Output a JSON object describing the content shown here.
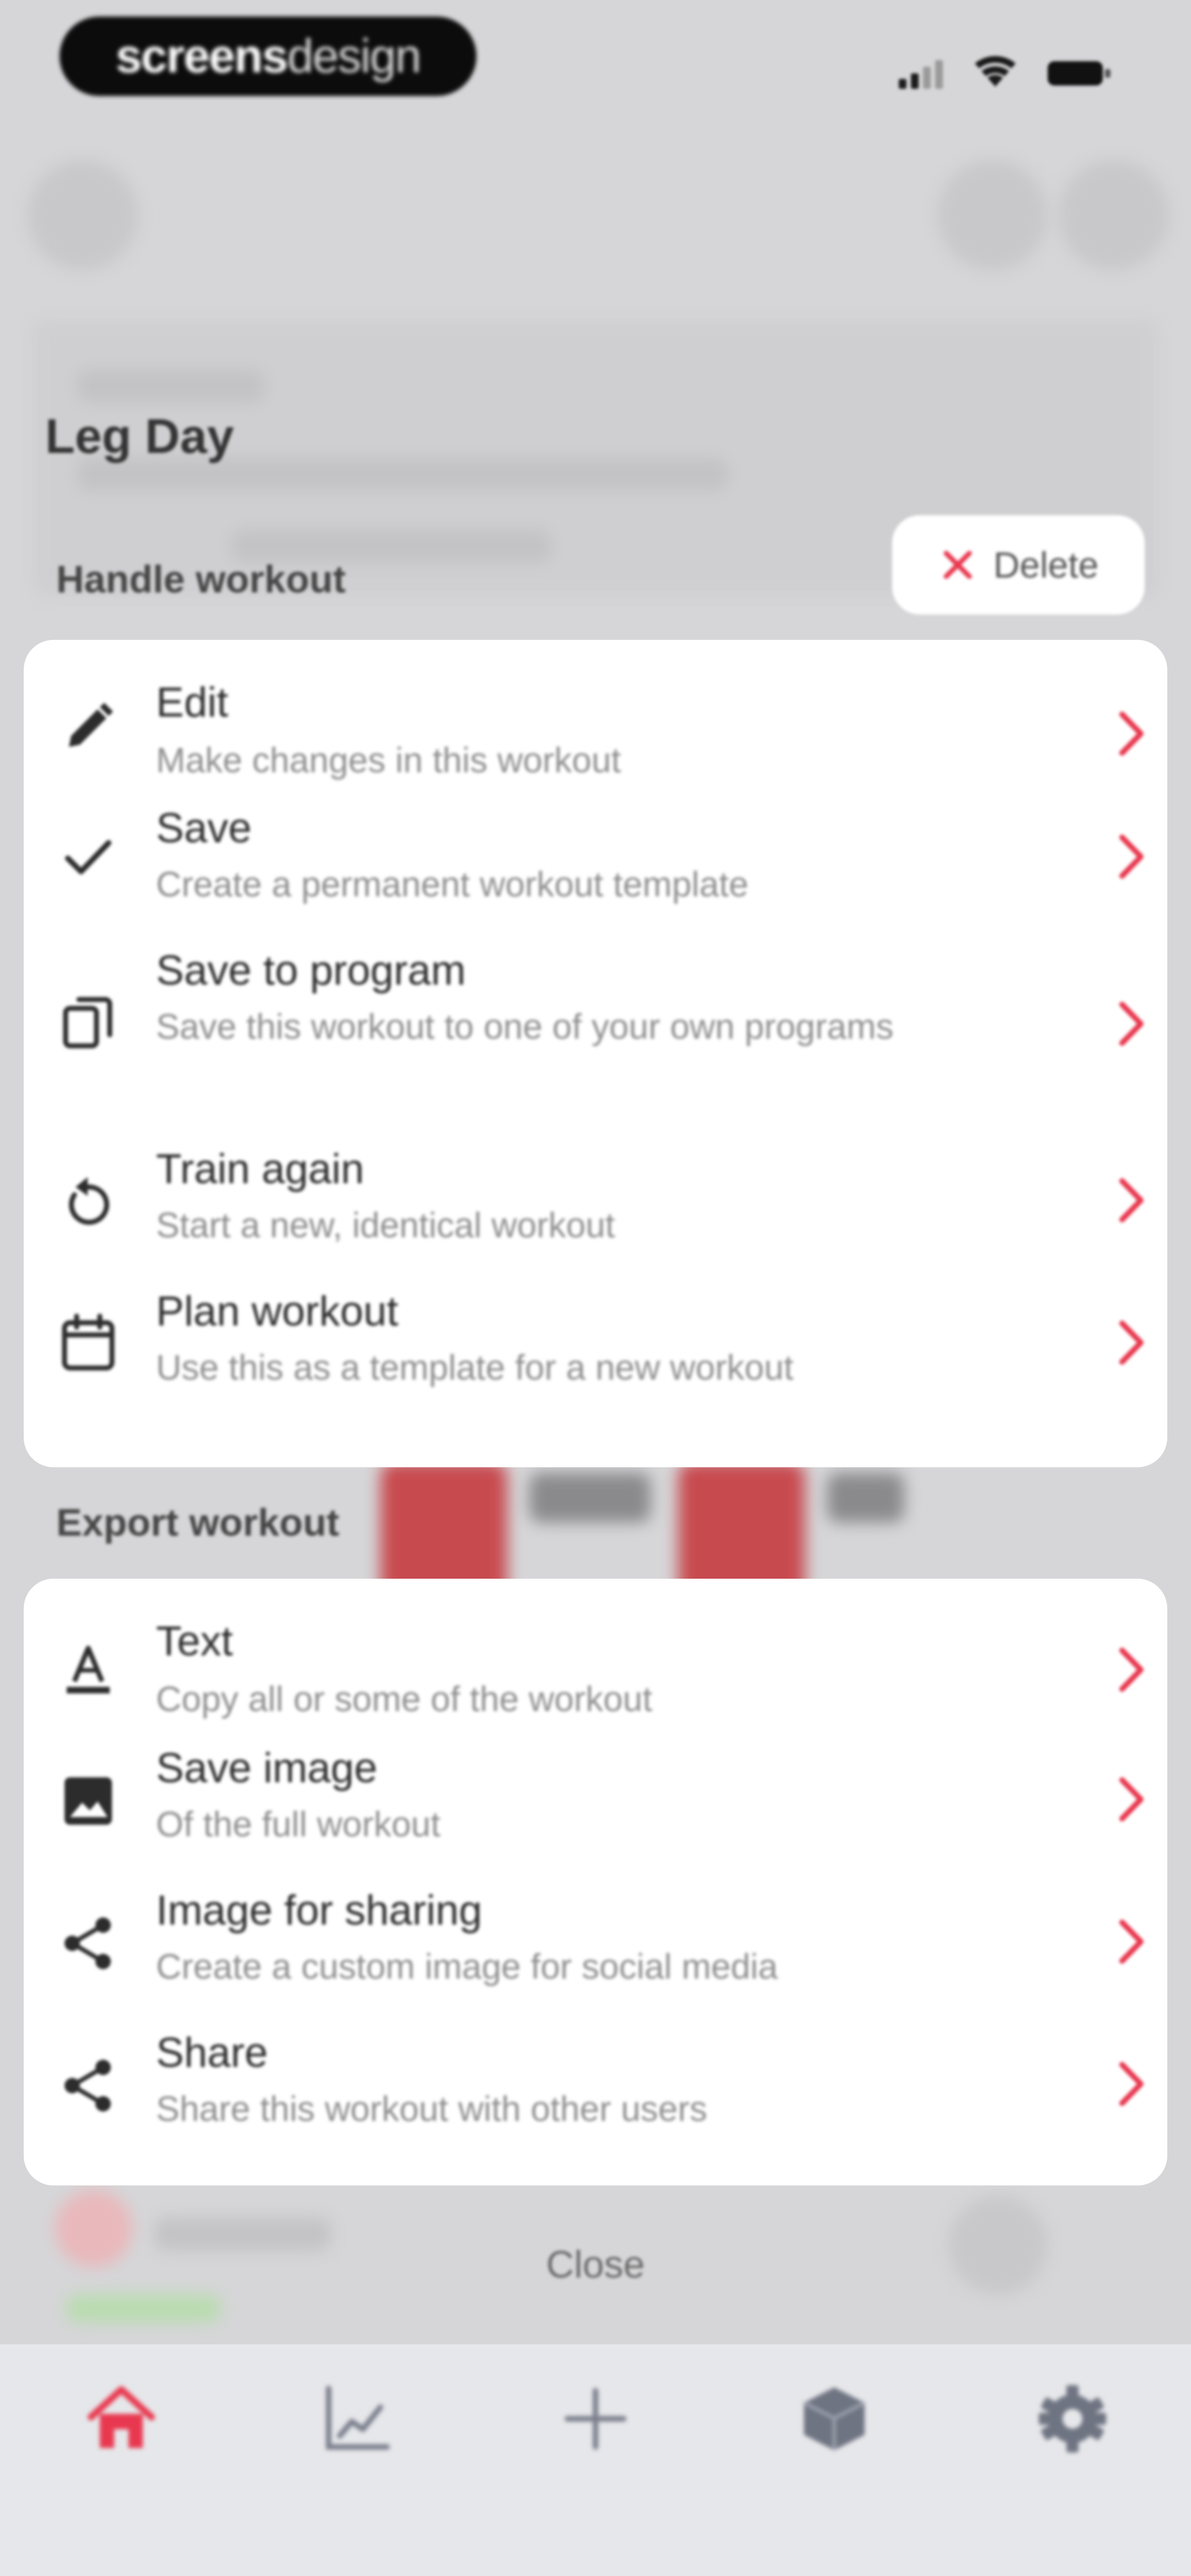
{
  "status_bar": {
    "brand_bold": "screens",
    "brand_light": "design"
  },
  "sheet": {
    "title": "Leg Day",
    "delete_label": "Delete",
    "handle_section_label": "Handle workout",
    "export_section_label": "Export workout",
    "handle_items": [
      {
        "icon": "pencil-icon",
        "title": "Edit",
        "subtitle": "Make changes in this workout"
      },
      {
        "icon": "checkmark-icon",
        "title": "Save",
        "subtitle": "Create a permanent workout template"
      },
      {
        "icon": "copy-icon",
        "title": "Save to program",
        "subtitle": "Save this workout to one of your own programs"
      },
      {
        "icon": "repeat-icon",
        "title": "Train again",
        "subtitle": "Start a new, identical workout"
      },
      {
        "icon": "calendar-icon",
        "title": "Plan workout",
        "subtitle": "Use this as a template for a new workout"
      }
    ],
    "export_items": [
      {
        "icon": "text-format-icon",
        "title": "Text",
        "subtitle": "Copy all or some of the workout"
      },
      {
        "icon": "image-icon",
        "title": "Save image",
        "subtitle": "Of the full workout"
      },
      {
        "icon": "share-icon",
        "title": "Image for sharing",
        "subtitle": "Create a custom image for social media"
      },
      {
        "icon": "share-icon",
        "title": "Share",
        "subtitle": "Share this workout with other users"
      }
    ],
    "close_label": "Close"
  },
  "tabbar": {
    "tabs": [
      {
        "icon": "home-icon",
        "active": true
      },
      {
        "icon": "chart-icon",
        "active": false
      },
      {
        "icon": "plus-icon",
        "active": false
      },
      {
        "icon": "cube-icon",
        "active": false
      },
      {
        "icon": "gear-icon",
        "active": false
      }
    ]
  },
  "colors": {
    "accent": "#e8384f",
    "background": "#d6d6d8",
    "card": "#ffffff",
    "tabbar": "#e6e7ea"
  }
}
